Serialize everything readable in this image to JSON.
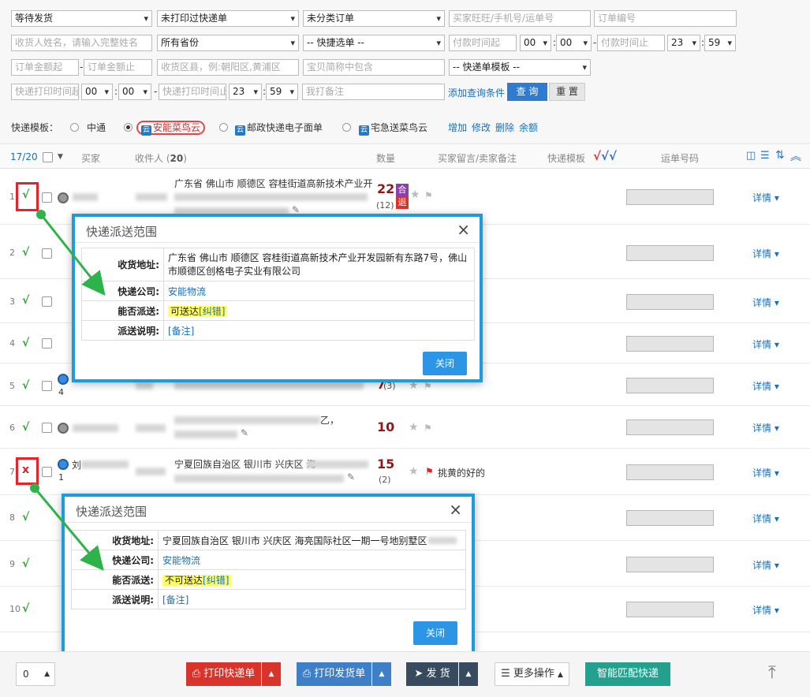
{
  "filters": {
    "row1": {
      "status": "等待发货",
      "print_status": "未打印过快递单",
      "category": "未分类订单",
      "buyer_placeholder": "买家旺旺/手机号/运单号",
      "order_no_placeholder": "订单编号"
    },
    "row2": {
      "receiver_placeholder": "收货人姓名，请输入完整姓名",
      "province": "所有省份",
      "quick": "-- 快捷选单 --",
      "pay_start_placeholder": "付款时间起",
      "pay_start_h": "00",
      "pay_start_m": "00",
      "pay_end_placeholder": "付款时间止",
      "pay_end_h": "23",
      "pay_end_m": "59"
    },
    "row3": {
      "amount_min_placeholder": "订单金额起",
      "amount_max_placeholder": "订单金额止",
      "district_placeholder": "收货区县，例:朝阳区,黄浦区",
      "item_placeholder": "宝贝简称中包含",
      "template": "-- 快递单模板 --"
    },
    "row4": {
      "print_start_placeholder": "快递打印时间起",
      "print_start_h": "00",
      "print_start_m": "00",
      "print_end_placeholder": "快递打印时间止",
      "print_end_h": "23",
      "print_end_m": "59",
      "remark_placeholder": "我打备注",
      "add_condition": "添加查询条件",
      "query": "查 询",
      "reset": "重 置"
    }
  },
  "templates": {
    "label": "快递模板：",
    "options": [
      "中通",
      "安能菜鸟云",
      "邮政快递电子面单",
      "宅急送菜鸟云"
    ],
    "actions": [
      "增加",
      "修改",
      "删除",
      "余额"
    ]
  },
  "list_header": {
    "count": "17/20",
    "buyer": "买家",
    "receiver": "收件人",
    "receiver_count": "20",
    "quantity": "数量",
    "message": "买家留言/卖家备注",
    "template": "快递模板",
    "waybill": "运单号码"
  },
  "rows": [
    {
      "num": "1",
      "mark": "√",
      "qty": "22",
      "sub": "(12)",
      "addr": "广东省 佛山市 顺德区 容桂街道高新技术产业开",
      "badge1": "合",
      "badge2": "退"
    },
    {
      "num": "2",
      "mark": "√"
    },
    {
      "num": "3",
      "mark": "√"
    },
    {
      "num": "4",
      "mark": "√"
    },
    {
      "num": "5",
      "mark": "√",
      "qty": "7",
      "sub": "(3)",
      "count": "4"
    },
    {
      "num": "6",
      "mark": "√",
      "qty": "10",
      "addr_tail": "乙，"
    },
    {
      "num": "7",
      "mark": "x",
      "qty": "15",
      "sub": "(2)",
      "addr": "宁夏回族自治区 银川市 兴庆区 海",
      "buyer": "刘",
      "count": "1",
      "note": "挑黄的好的"
    },
    {
      "num": "8",
      "mark": "√"
    },
    {
      "num": "9",
      "mark": "√"
    },
    {
      "num": "10",
      "mark": "√"
    }
  ],
  "row_detail_label": "详情",
  "modal1": {
    "title": "快递派送范围",
    "address_label": "收货地址:",
    "address": "广东省 佛山市 顺德区 容桂街道高新技术产业开发园新有东路7号，佛山市顺德区创格电子实业有限公司",
    "company_label": "快递公司:",
    "company": "安能物流",
    "deliver_label": "能否派送:",
    "deliver": "可送达",
    "correct": "[纠错]",
    "note_label": "派送说明:",
    "note": "[备注]",
    "close": "关闭"
  },
  "modal2": {
    "title": "快递派送范围",
    "address_label": "收货地址:",
    "address": "宁夏回族自治区 银川市 兴庆区 海亮国际社区一期一号地别墅区",
    "company_label": "快递公司:",
    "company": "安能物流",
    "deliver_label": "能否派送:",
    "deliver": "不可送达",
    "correct": "[纠错]",
    "note_label": "派送说明:",
    "note": "[备注]",
    "close": "关闭"
  },
  "bottom": {
    "page_size": "0",
    "print_express": "打印快递单",
    "print_delivery": "打印发货单",
    "ship": "发 货",
    "more": "更多操作",
    "smart_match": "智能匹配快递"
  },
  "colors": {
    "accent_blue": "#2f7bd0",
    "modal_border": "#1c9bde",
    "print_red": "#d9342b",
    "print_blue": "#3f7fc7",
    "ship_dark": "#384a5e",
    "smart_teal": "#23a08e",
    "ok_green": "#2aa52a",
    "bad_red": "#d22222",
    "highlight": "#ffff66"
  }
}
